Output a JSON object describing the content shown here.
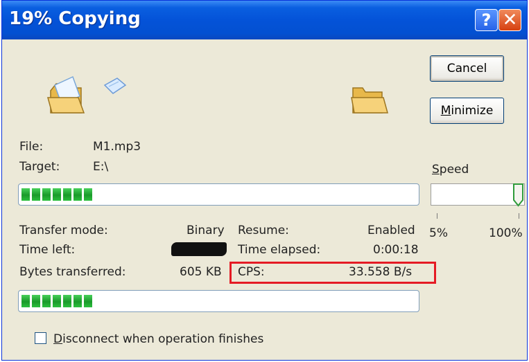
{
  "window": {
    "title": "19% Copying"
  },
  "buttons": {
    "cancel": "Cancel",
    "minimize_u": "M",
    "minimize_rest": "inimize"
  },
  "file": {
    "label": "File:",
    "value": "M1.mp3"
  },
  "target": {
    "label": "Target:",
    "value": "E:\\"
  },
  "progress": {
    "file_fraction": 0.19,
    "total_fraction": 0.19
  },
  "stats": {
    "transfer_mode_label": "Transfer mode:",
    "transfer_mode_value": "Binary",
    "resume_label": "Resume:",
    "resume_value": "Enabled",
    "time_left_label": "Time left:",
    "time_elapsed_label": "Time elapsed:",
    "time_elapsed_value": "0:00:18",
    "bytes_label": "Bytes transferred:",
    "bytes_value": "605 KB",
    "cps_label": "CPS:",
    "cps_value": "33.558 B/s"
  },
  "speed": {
    "label_u": "S",
    "label_rest": "peed",
    "min": "5%",
    "max": "100%",
    "level_percent": 100
  },
  "disconnect": {
    "label_u": "D",
    "label_rest": "isconnect when operation finishes",
    "checked": false
  },
  "icons": {
    "source": "folder-open-icon",
    "flying": "flying-document-icon",
    "destination": "folder-icon"
  },
  "colors": {
    "title_bar": "#0453d8",
    "progress": "#2cbf3e",
    "highlight_box": "#e51b24"
  }
}
